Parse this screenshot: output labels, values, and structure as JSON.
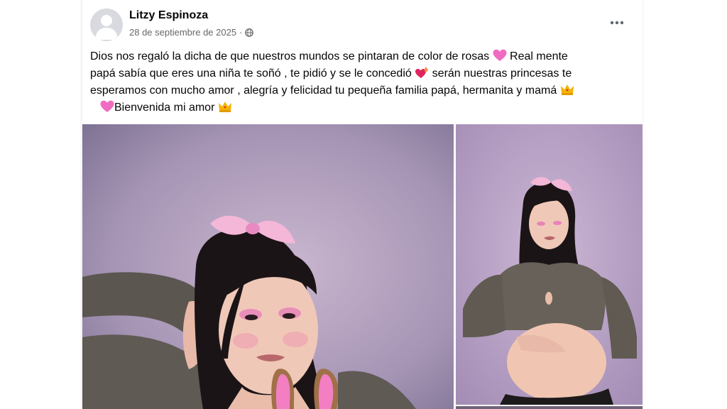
{
  "post": {
    "author": "Litzy Espinoza",
    "date": "28 de septiembre de 2025",
    "separator": "·",
    "audience_icon": "globe-icon",
    "more_icon": "more-horizontal-icon",
    "text": {
      "line1": "Dios nos regaló la dicha de que nuestros mundos se pintaran de color de rosas ",
      "line1b": " Real mente",
      "line2": "papá sabía que eres una niña te soñó , te pidió y se le concedió ",
      "line2b": " serán nuestras princesas te",
      "line3": "esperamos con mucho amor , alegría y felicidad tu pequeña familia papá, hermanita y mamá ",
      "line4": "Bienvenida mi amor "
    },
    "emojis": [
      "pink-heart-icon",
      "heart-on-fire-icon",
      "crown-icon",
      "pink-heart-icon",
      "crown-icon"
    ],
    "photos": [
      "photo-left",
      "photo-right"
    ]
  },
  "colors": {
    "name": "#050505",
    "meta": "#65676b",
    "heart": "#f06cc0",
    "crown": "#f5b400"
  }
}
